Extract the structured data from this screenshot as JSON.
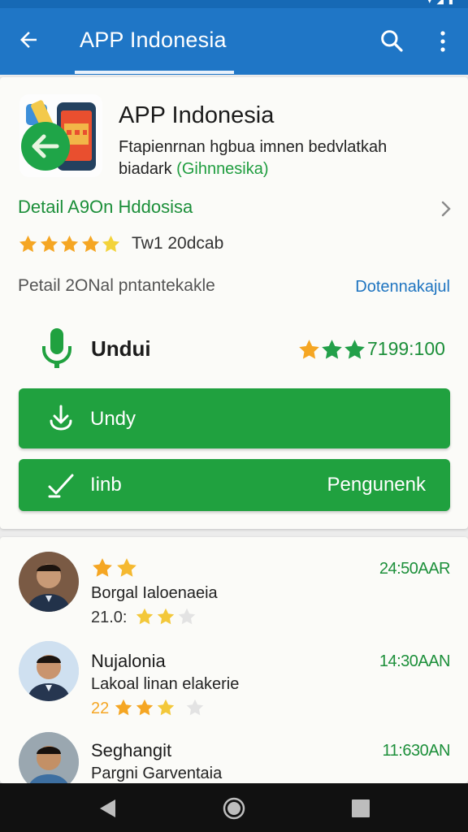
{
  "appbar": {
    "title": "APP Indonesia"
  },
  "app": {
    "name": "APP Indonesia",
    "desc_line1": "Ftapienrnan hgbua imnen bedvlatkah",
    "desc_line2_a": "biadark ",
    "desc_line2_b": "(Gihnnesika)",
    "detail_link": "Detail A9On Hddosisa",
    "rating_text": "Tw1 20dcab",
    "rating_stars": 5,
    "info_text": "Petail 2ONal pntantekakle",
    "info_link": "Dotennakajul",
    "download_label": "Undui",
    "download_count": "7199:100",
    "download_button": "Undy",
    "install_button_left": "Iinb",
    "install_button_right": "Pengunenk"
  },
  "reviews": [
    {
      "time": "24:50AAR",
      "text": "Borgal Ialoenaeia",
      "num": "21.0:"
    },
    {
      "name": "Nujalonia",
      "time": "14:30AAN",
      "text": "Lakoal linan elakerie",
      "num": "22"
    },
    {
      "name": "Seghangit",
      "time": "11:630AN",
      "text": "Pargni Garventaia"
    }
  ],
  "colors": {
    "appbar": "#1f76c6",
    "accent_green": "#20a13f",
    "link_blue": "#1e74c0",
    "star_orange": "#f5a623",
    "star_yellow": "#f3d33a",
    "star_green": "#23a04a"
  },
  "icons": [
    "back-arrow-icon",
    "search-icon",
    "more-vert-icon",
    "chevron-right-icon",
    "mic-icon",
    "download-icon",
    "check-icon",
    "nav-back-icon",
    "nav-home-icon",
    "nav-recent-icon"
  ]
}
